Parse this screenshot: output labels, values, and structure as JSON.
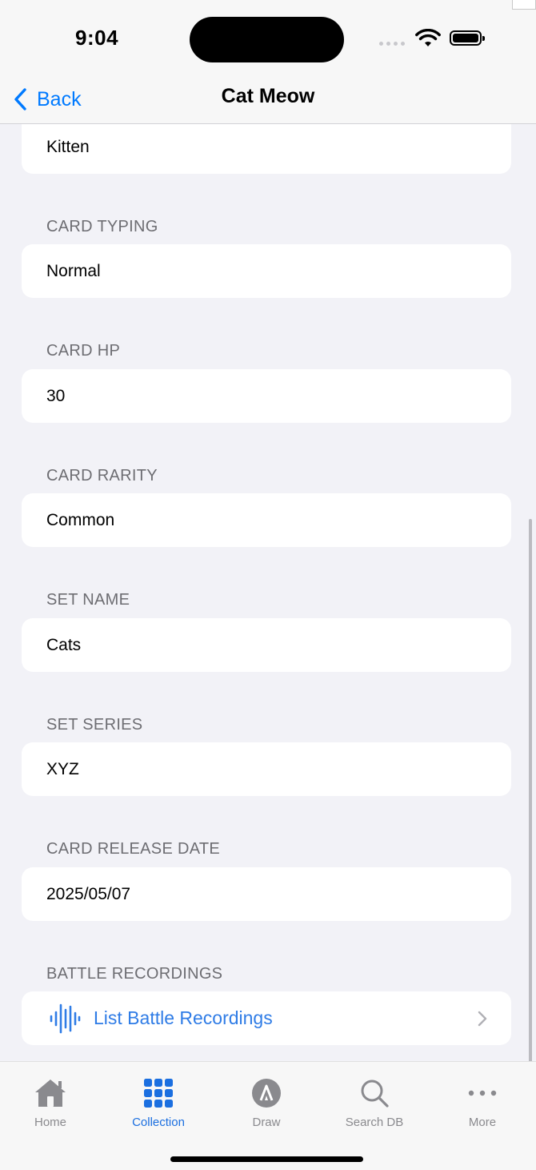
{
  "status_bar": {
    "time": "9:04"
  },
  "nav": {
    "back_label": "Back",
    "title": "Cat Meow"
  },
  "fields": {
    "top_value": "Kitten",
    "card_typing": {
      "label": "CARD TYPING",
      "value": "Normal"
    },
    "card_hp": {
      "label": "CARD HP",
      "value": "30"
    },
    "card_rarity": {
      "label": "CARD RARITY",
      "value": "Common"
    },
    "set_name": {
      "label": "SET NAME",
      "value": "Cats"
    },
    "set_series": {
      "label": "SET SERIES",
      "value": "XYZ"
    },
    "card_release_date": {
      "label": "CARD RELEASE DATE",
      "value": "2025/05/07"
    }
  },
  "battle_recordings": {
    "label": "BATTLE RECORDINGS",
    "link_label": "List Battle Recordings",
    "icon": "waveform-icon"
  },
  "tab_bar": {
    "home": {
      "label": "Home",
      "icon": "house-icon"
    },
    "collection": {
      "label": "Collection",
      "icon": "grid-icon",
      "active": true
    },
    "draw": {
      "label": "Draw",
      "icon": "draw-icon"
    },
    "search": {
      "label": "Search DB",
      "icon": "magnifier-icon"
    },
    "more": {
      "label": "More",
      "icon": "ellipsis-icon"
    }
  },
  "colors": {
    "accent": "#007aff",
    "active_tab": "#1b6fe0",
    "background": "#f2f2f7",
    "header_text": "#6d6d72",
    "inactive_tab": "#8a8a8e"
  }
}
